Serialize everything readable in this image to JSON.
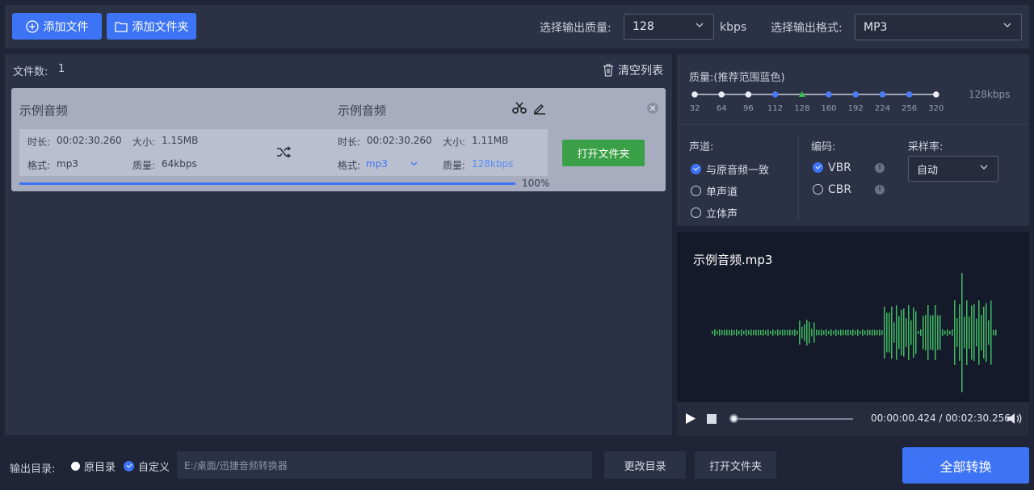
{
  "toolbar": {
    "add_file": "添加文件",
    "add_folder": "添加文件夹",
    "quality_label": "选择输出质量:",
    "quality_value": "128",
    "quality_unit": "kbps",
    "format_label": "选择输出格式:",
    "format_value": "MP3"
  },
  "list": {
    "count_label": "文件数:",
    "count_value": "1",
    "clear": "清空列表"
  },
  "file": {
    "src_name": "示例音频",
    "dst_name": "示例音频",
    "src_duration_label": "时长:",
    "src_duration": "00:02:30.260",
    "src_size_label": "大小:",
    "src_size": "1.15MB",
    "src_format_label": "格式:",
    "src_format": "mp3",
    "src_quality_label": "质量:",
    "src_quality": "64kbps",
    "dst_duration_label": "时长:",
    "dst_duration": "00:02:30.260",
    "dst_size_label": "大小:",
    "dst_size": "1.11MB",
    "dst_format_label": "格式:",
    "dst_format": "mp3",
    "dst_quality_label": "质量:",
    "dst_quality": "128kbps",
    "open_folder": "打开文件夹",
    "progress": 1.0,
    "progress_text": "100%"
  },
  "quality": {
    "title": "质量:(推荐范围蓝色)",
    "ticks": [
      "32",
      "64",
      "96",
      "112",
      "128",
      "160",
      "192",
      "224",
      "256",
      "320"
    ],
    "selected_index": 4,
    "current": "128kbps"
  },
  "settings": {
    "channel_label": "声道:",
    "channel_options": [
      "与原音频一致",
      "单声道",
      "立体声"
    ],
    "channel_selected": 0,
    "encoding_label": "编码:",
    "encoding_options": [
      "VBR",
      "CBR"
    ],
    "encoding_selected": 0,
    "samplerate_label": "采样率:",
    "samplerate_value": "自动"
  },
  "preview": {
    "file_name": "示例音频.mp3",
    "time": "00:00:00.424 / 00:02:30.256",
    "position": 0.0
  },
  "footer": {
    "output_label": "输出目录:",
    "option_original": "原目录",
    "option_custom": "自定义",
    "path": "E:/桌面/迅捷音频转换器",
    "change_dir": "更改目录",
    "open_folder": "打开文件夹",
    "convert_all": "全部转换"
  },
  "colors": {
    "accent": "#3d74f5",
    "green": "#3aa047",
    "selected_tick": "#31c24a"
  }
}
